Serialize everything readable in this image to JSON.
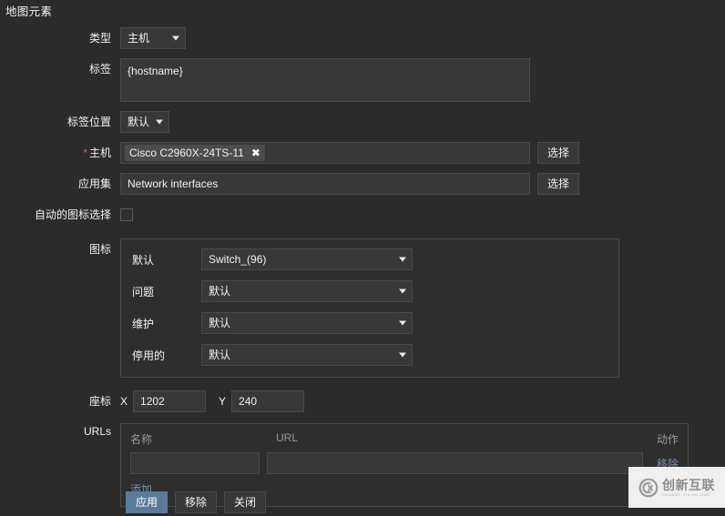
{
  "page": {
    "title": "地图元素"
  },
  "fields": {
    "type": {
      "label": "类型",
      "value": "主机"
    },
    "label": {
      "label": "标签",
      "value": "{hostname}"
    },
    "label_position": {
      "label": "标签位置",
      "value": "默认"
    },
    "host": {
      "label": "主机",
      "required": "*",
      "chip": "Cisco C2960X-24TS-11",
      "chip_remove_icon": "✖",
      "select_button": "选择"
    },
    "application_set": {
      "label": "应用集",
      "value": "Network interfaces",
      "select_button": "选择"
    },
    "auto_icon": {
      "label": "自动的图标选择",
      "checked": false
    },
    "icons": {
      "label": "图标",
      "rows": [
        {
          "label": "默认",
          "value": "Switch_(96)"
        },
        {
          "label": "问题",
          "value": "默认"
        },
        {
          "label": "维护",
          "value": "默认"
        },
        {
          "label": "停用的",
          "value": "默认"
        }
      ]
    },
    "coordinates": {
      "label": "座标",
      "x_label": "X",
      "x_value": "1202",
      "y_label": "Y",
      "y_value": "240"
    },
    "urls": {
      "label": "URLs",
      "headers": {
        "name": "名称",
        "url": "URL",
        "action": "动作"
      },
      "rows": [
        {
          "name": "",
          "url": "",
          "remove": "移除"
        }
      ],
      "add_link": "添加"
    }
  },
  "footer": {
    "apply": "应用",
    "remove": "移除",
    "close": "关闭"
  },
  "watermark": {
    "cn": "创新互联",
    "en": "CHUANG XIN HU LIAN"
  },
  "colors": {
    "background": "#2b2b2b",
    "field_bg": "#383838",
    "field_border": "#4a4a4a",
    "accent": "#5c7b99",
    "link": "#768fb5",
    "required": "#d45c5c"
  }
}
